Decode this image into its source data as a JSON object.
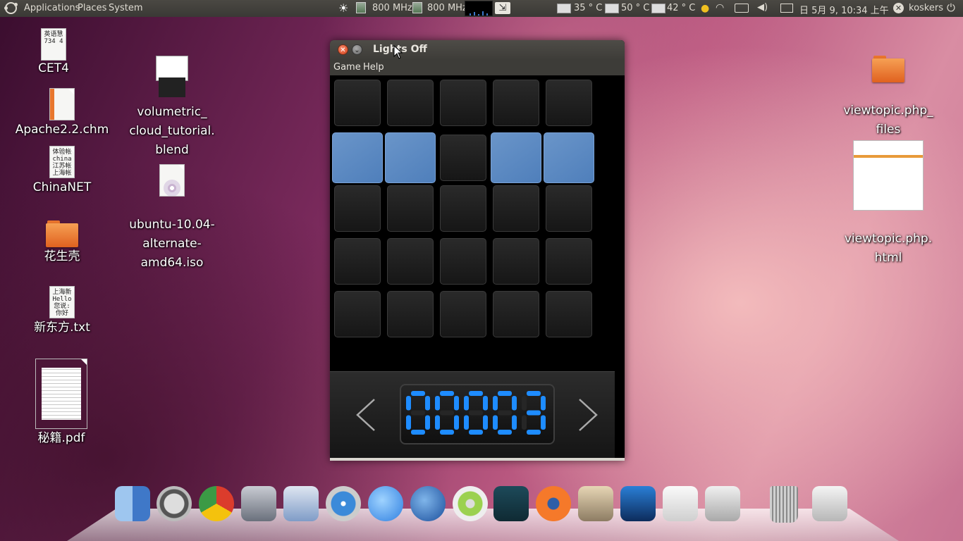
{
  "panel": {
    "menus": [
      "Applications",
      "Places",
      "System"
    ],
    "cpu_freq_1": "800 MHz",
    "cpu_freq_2": "800 MHz",
    "temp_1": "35 ° C",
    "temp_2": "50 ° C",
    "temp_3": "42 ° C",
    "clock": "日 5月 9, 10:34 上午",
    "user": "koskers",
    "icons": [
      "ubuntu-logo-icon",
      "weather-sun-icon",
      "cpu-chip-icon",
      "system-monitor-graph",
      "screenshot-icon",
      "disk-icon",
      "thermometer-icon",
      "qq-icon",
      "wifi-icon",
      "keyboard-icon",
      "volume-icon",
      "mail-icon",
      "user-close-icon",
      "power-icon"
    ]
  },
  "desktop_left": [
    {
      "label": "CET4",
      "thumb": [
        "英语慧",
        "734 4"
      ]
    },
    {
      "label": "volumetric_\ncloud_tutorial.\nblend"
    },
    {
      "label": "Apache2.2.chm"
    },
    {
      "label": "ChinaNET",
      "thumb": [
        "体验帐",
        "china",
        "江苏帐",
        "上海帐"
      ]
    },
    {
      "label": "ubuntu-10.04-\nalternate-\namd64.iso"
    },
    {
      "label": "花生壳"
    },
    {
      "label": "新东方.txt",
      "thumb": [
        "上海新",
        "Hello",
        "您说:",
        "你好"
      ]
    },
    {
      "label": "秘籍.pdf"
    }
  ],
  "desktop_right": [
    {
      "label": "viewtopic.php_\nfiles"
    },
    {
      "label": "viewtopic.php.\nhtml"
    }
  ],
  "window": {
    "title": "Lights Off",
    "menu": [
      "Game",
      "Help"
    ],
    "board": [
      [
        0,
        0,
        0,
        0,
        0
      ],
      [
        1,
        1,
        0,
        1,
        1
      ],
      [
        0,
        0,
        0,
        0,
        0
      ],
      [
        0,
        0,
        0,
        0,
        0
      ],
      [
        0,
        0,
        0,
        0,
        0
      ]
    ],
    "level": "00003",
    "on_color": "#4f7fbb",
    "digit_color": "#1e8cff"
  },
  "dock": {
    "apps": [
      "finder-icon",
      "time-machine-icon",
      "chrome-icon",
      "system-monitor-icon",
      "mail-stamp-icon",
      "safari-icon",
      "ichat-icon",
      "rhythmbox-icon",
      "itunes-icon",
      "xbmc-icon",
      "blender-icon",
      "photos-icon",
      "imovie-icon",
      "text-editor-icon",
      "toaster-icon",
      "trash-icon",
      "drive-icon"
    ]
  }
}
